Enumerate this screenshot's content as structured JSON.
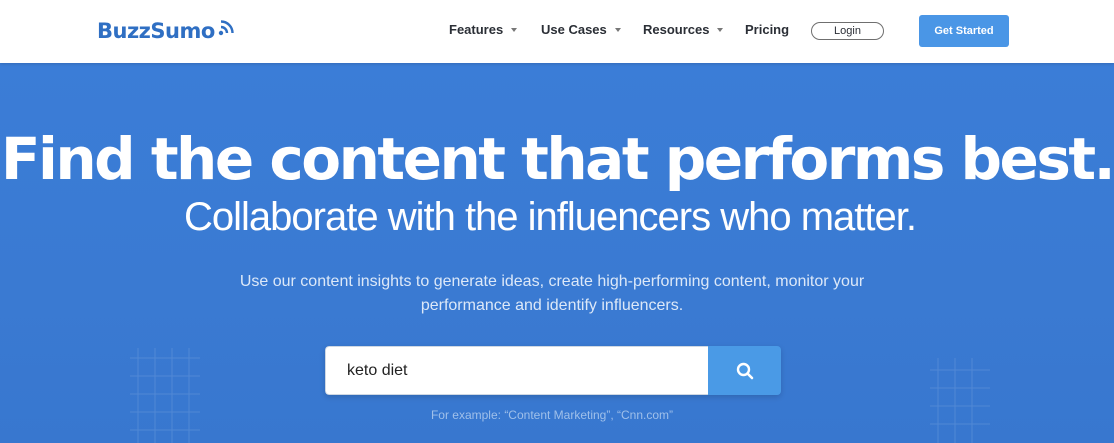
{
  "brand": {
    "name": "BuzzSumo",
    "primary_color": "#2f6fc3",
    "hero_color": "#3b7dd7",
    "cta_color": "#4a96e6"
  },
  "nav": {
    "items": [
      {
        "label": "Features",
        "has_dropdown": true
      },
      {
        "label": "Use Cases",
        "has_dropdown": true
      },
      {
        "label": "Resources",
        "has_dropdown": true
      },
      {
        "label": "Pricing",
        "has_dropdown": false
      }
    ],
    "login_label": "Login",
    "cta_label": "Get Started"
  },
  "hero": {
    "headline": "Find the content that performs best.",
    "subheadline": "Collaborate with the influencers who matter.",
    "description_line1": "Use our content insights to generate ideas, create high-performing content, monitor your",
    "description_line2": "performance and identify influencers.",
    "search": {
      "value": "keto diet",
      "button_icon": "search-icon"
    },
    "example_text": "For example: “Content Marketing”, “Cnn.com”"
  }
}
